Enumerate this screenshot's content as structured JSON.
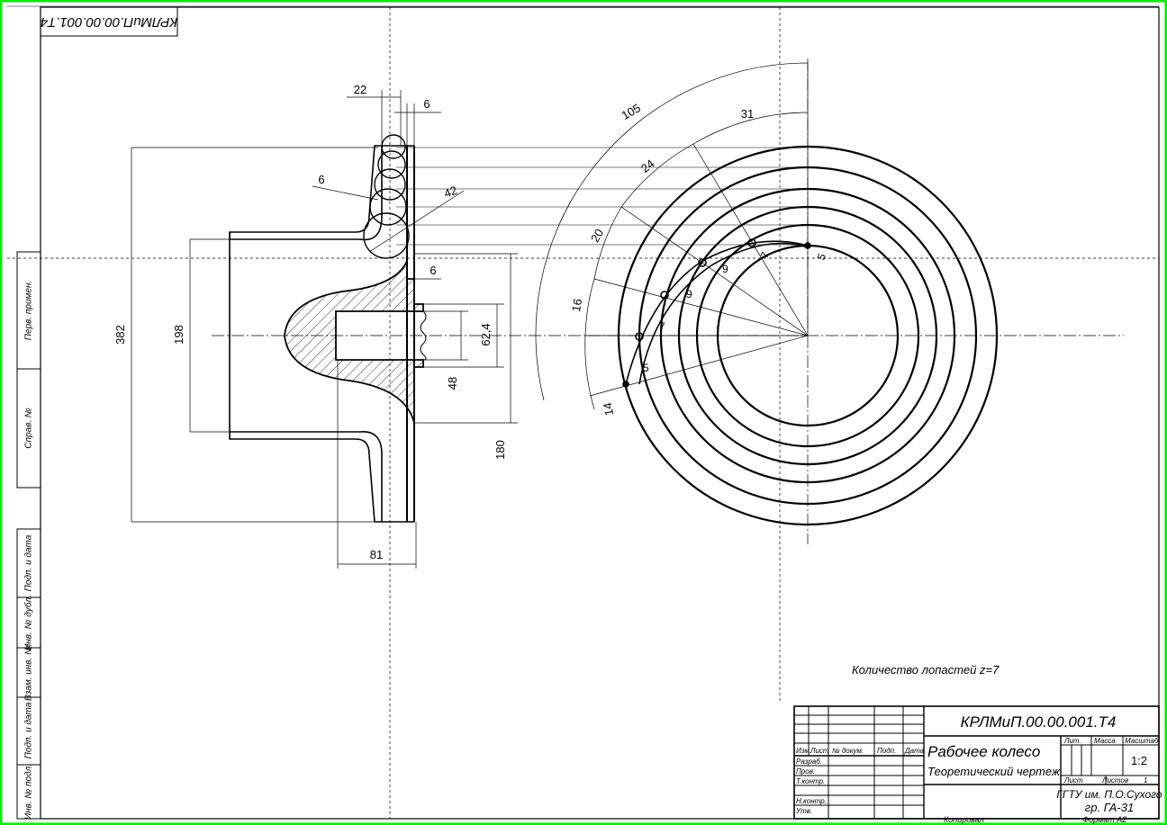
{
  "stamp_rotated": "КРЛМиП.00.00.001.Т4",
  "side_columns": [
    "Перв. примен.",
    "Справ. №",
    "Подп. и дата",
    "Инв. № дубл.",
    "Взам. инв. №",
    "Подп. и дата",
    "Инв. № подл."
  ],
  "dims": {
    "d22": "22",
    "d6_top": "6",
    "d6_fillet": "6",
    "d42": "42",
    "d6_hub": "6",
    "d382": "382",
    "d198": "198",
    "d62_4": "62,4",
    "d48": "48",
    "d180": "180",
    "d81": "81"
  },
  "angles": {
    "a105": "105",
    "a31": "31",
    "a24": "24",
    "a20": "20",
    "a16": "16",
    "a14": "14",
    "r5a": "5",
    "r7a": "7",
    "r9a": "9",
    "r9b": "9",
    "r7b": "7",
    "r5b": "5"
  },
  "note": "Количество лопастей z=7",
  "title_block": {
    "designation": "КРЛМиП.00.00.001.Т4",
    "name": "Рабочее колесо",
    "doc_type": "Теоретический чертеж",
    "h_izm": "Изм.",
    "h_list": "Лист",
    "h_docnum": "№ докум.",
    "h_sign": "Подп.",
    "h_date": "Дата",
    "r_razrab": "Разраб.",
    "r_prov": "Пров.",
    "r_tkontr": "Т.контр.",
    "r_nkontr": "Н.контр.",
    "r_utv": "Утв.",
    "lit": "Лит.",
    "massa": "Масса",
    "masshtab": "Масштаб",
    "scale": "1:2",
    "list": "Лист",
    "listov": "Листов",
    "listov_val": "1",
    "org": "ГГТУ им. П.О.Сухого",
    "group": "гр. ГА-31",
    "kopiroval": "Копировал",
    "format": "Формат А2"
  },
  "colors": {
    "frame_green": "#00ee00",
    "ink": "#000000"
  }
}
